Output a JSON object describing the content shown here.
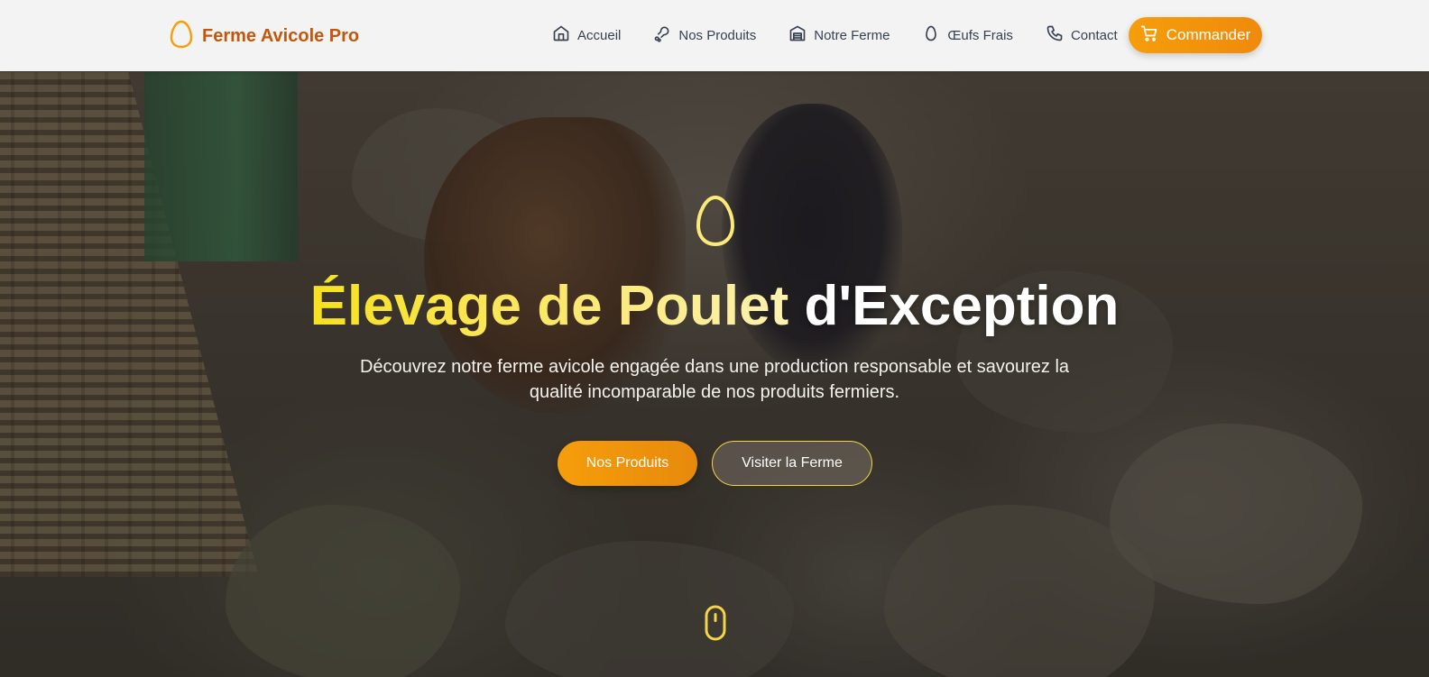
{
  "header": {
    "brand_name": "Ferme Avicole Pro",
    "brand_icon": "egg-icon",
    "nav": [
      {
        "label": "Accueil",
        "icon": "home-icon"
      },
      {
        "label": "Nos Produits",
        "icon": "drumstick-icon"
      },
      {
        "label": "Notre Ferme",
        "icon": "warehouse-icon"
      },
      {
        "label": "Œufs Frais",
        "icon": "egg-icon"
      },
      {
        "label": "Contact",
        "icon": "phone-icon"
      }
    ],
    "order_button": {
      "label": "Commander",
      "icon": "cart-icon"
    }
  },
  "hero": {
    "title_accent": "Élevage de Poulet",
    "title_rest": "d'Exception",
    "subtitle": "Découvrez notre ferme avicole engagée dans une production responsable et savourez la qualité incomparable de nos produits fermiers.",
    "primary_button": "Nos Produits",
    "secondary_button": "Visiter la Ferme",
    "hero_icon": "egg-icon",
    "scroll_icon": "mouse-scroll-icon"
  },
  "colors": {
    "brand": "#c2570c",
    "accent": "#f59e0b",
    "title_gold": "#f7e11e",
    "nav_text": "#374151",
    "header_bg": "#f3f3f3"
  }
}
